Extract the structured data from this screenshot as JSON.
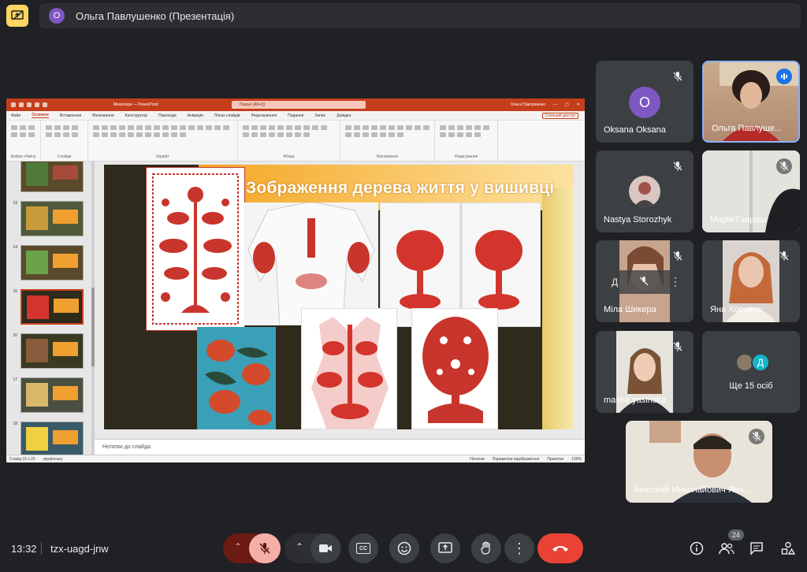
{
  "presenter_bar": {
    "avatar_letter": "О",
    "title": "Ольга Павлушенко (Презентація)",
    "present_icon": "present-to-all-icon"
  },
  "powerpoint": {
    "filename": "Мініатюри — PowerPoint",
    "search_placeholder": "Пошук (Alt+Q)",
    "user": "Ольга Павлушенко",
    "menu": [
      "Файл",
      "Основне",
      "Вставлення",
      "Малювання",
      "Конструктор",
      "Переходи",
      "Анімація",
      "Показ слайдів",
      "Рецензування",
      "Подання",
      "Запис",
      "Довідка"
    ],
    "active_menu": "Основне",
    "share_label": "Спільний доступ",
    "ribbon_groups": [
      "Буфер обміну",
      "Слайди",
      "Шрифт",
      "Абзац",
      "Малювання",
      "Редагування"
    ],
    "slide_numbers": [
      "13",
      "14",
      "15",
      "16",
      "17",
      "18"
    ],
    "active_slide": "15",
    "slide_title": "Зображення дерева життя у вишивці",
    "notes_placeholder": "Нотатки до слайда",
    "status_left": "Слайд 15 з 25",
    "status_lang": "українська",
    "status_notes": "Нотатки",
    "status_display": "Параметри відображення",
    "status_comments": "Примітки",
    "status_zoom": "100%"
  },
  "participants": [
    {
      "name": "Oksana Oksana",
      "avatar_letter": "O",
      "avatar_color": "#7e57c2",
      "muted": true
    },
    {
      "name": "Ольга Павлуше...",
      "speaking": true
    },
    {
      "name": "Nastya Storozhyk",
      "muted": true
    },
    {
      "name": "Марія Гавриш",
      "muted": true
    },
    {
      "name": "Міла Шикера",
      "muted": true
    },
    {
      "name": "Яна Хоружук",
      "muted": true
    },
    {
      "name": "masha yasinska",
      "muted": true
    },
    {
      "name": "Ще 15 осіб",
      "avatar_letter": "Д",
      "avatar_color": "#12b5cb"
    },
    {
      "name": "Анатолій Миколайович Янч...",
      "muted": true
    }
  ],
  "bottom_bar": {
    "time": "13:32",
    "meeting_code": "tzx-uagd-jnw",
    "people_count": "24",
    "controls": [
      "mic-off-icon",
      "camera-icon",
      "captions-icon",
      "emoji-icon",
      "present-icon",
      "raise-hand-icon",
      "more-options-icon",
      "end-call-icon"
    ],
    "right_controls": [
      "info-icon",
      "people-icon",
      "chat-icon",
      "activities-icon"
    ],
    "captions_text": "CC"
  }
}
